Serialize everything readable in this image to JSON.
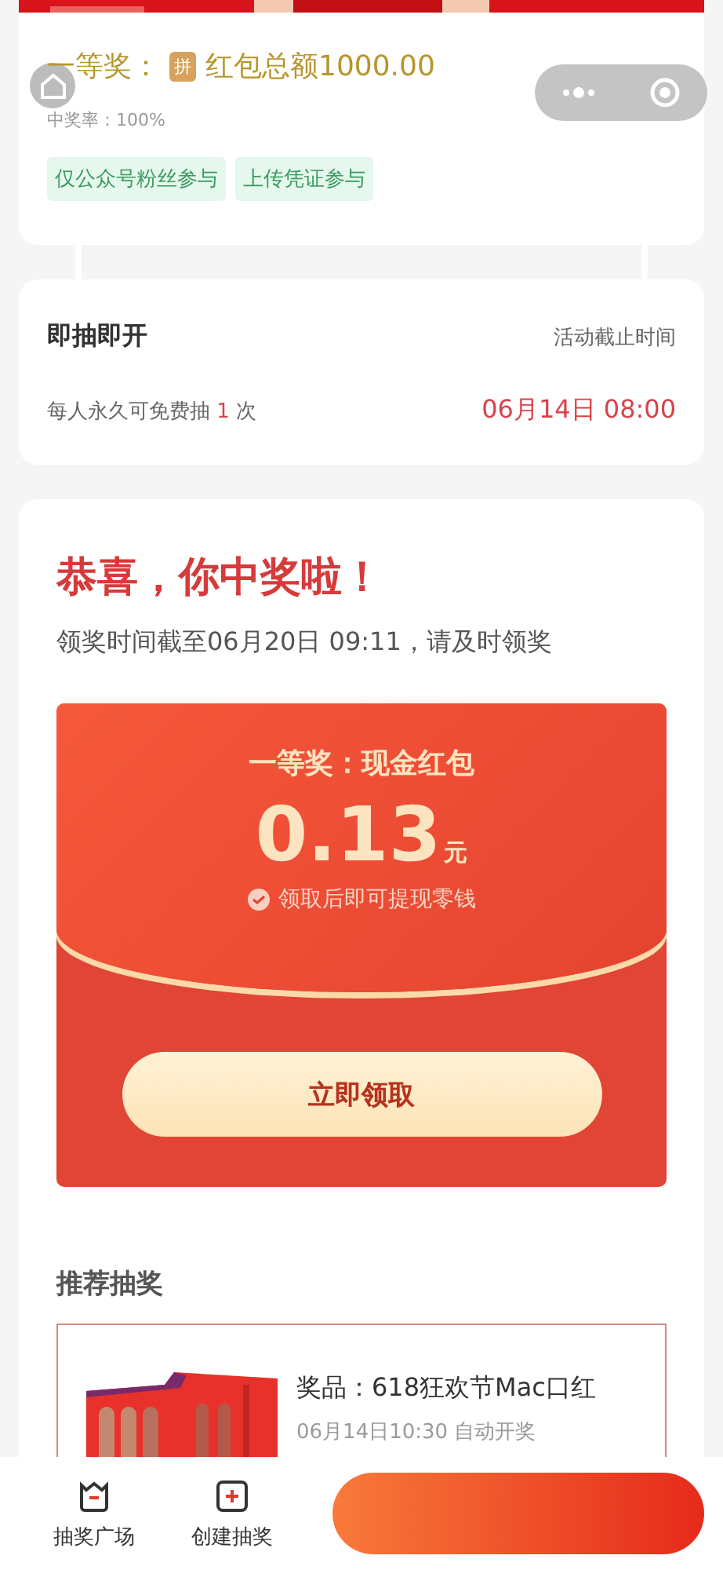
{
  "prize_card": {
    "prize_label": "一等奖：",
    "prize_badge": "拼",
    "prize_text": "红包总额1000.00",
    "win_rate": "中奖率：100%",
    "tags": [
      "仅公众号粉丝参与",
      "上传凭证参与"
    ]
  },
  "rules_card": {
    "title": "即抽即开",
    "deadline_label": "活动截止时间",
    "limit_text": "每人永久可免费抽 **1** 次",
    "deadline": "06月14日 08:00"
  },
  "result_card": {
    "title": "恭喜，你中奖啦！",
    "subtitle": "领奖时间截至06月20日 09:11，请及时领奖",
    "envelope": {
      "prize_name": "一等奖：现金红包",
      "amount": "0.13",
      "unit": "元",
      "note": "领取后即可提现零钱",
      "claim_button": "立即领取"
    },
    "recommend_title": "推荐抽奖",
    "recommend_items": [
      {
        "prize": "奖品：618狂欢节Mac口红",
        "time": "06月14日10:30 自动开奖"
      }
    ]
  },
  "bottom_bar": {
    "tabs": [
      {
        "label": "抽奖广场",
        "kind": "square"
      },
      {
        "label": "创建抽奖",
        "kind": "create"
      }
    ]
  }
}
